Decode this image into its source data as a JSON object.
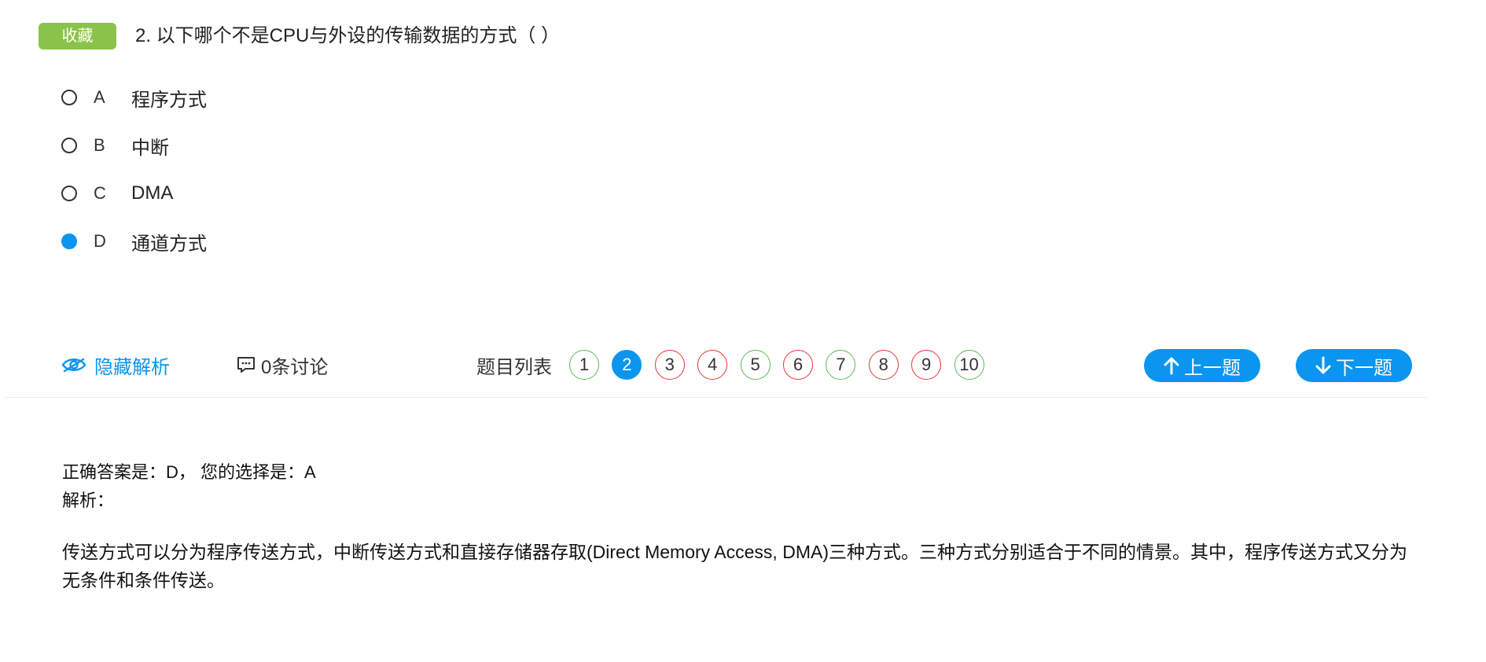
{
  "question": {
    "favorite_label": "收藏",
    "title": "2. 以下哪个不是CPU与外设的传输数据的方式（ ）",
    "options": [
      {
        "letter": "A",
        "text": "程序方式",
        "selected": false
      },
      {
        "letter": "B",
        "text": "中断",
        "selected": false
      },
      {
        "letter": "C",
        "text": "DMA",
        "selected": false
      },
      {
        "letter": "D",
        "text": "通道方式",
        "selected": true
      }
    ]
  },
  "toolbar": {
    "hide_analysis_label": "隐藏解析",
    "hide_analysis_icon": "eye-icon",
    "discussion_label": "0条讨论",
    "discussion_icon": "comment-icon",
    "question_list_label": "题目列表",
    "question_numbers": [
      {
        "num": "1",
        "status": "right"
      },
      {
        "num": "2",
        "status": "current"
      },
      {
        "num": "3",
        "status": "wrong"
      },
      {
        "num": "4",
        "status": "wrong"
      },
      {
        "num": "5",
        "status": "right"
      },
      {
        "num": "6",
        "status": "wrong"
      },
      {
        "num": "7",
        "status": "right"
      },
      {
        "num": "8",
        "status": "wrong"
      },
      {
        "num": "9",
        "status": "wrong"
      },
      {
        "num": "10",
        "status": "right"
      }
    ],
    "prev_label": "上一题",
    "next_label": "下一题"
  },
  "analysis": {
    "answer_line": "正确答案是：D， 您的选择是：A",
    "label": "解析：",
    "text": "传送方式可以分为程序传送方式，中断传送方式和直接存储器存取(Direct Memory Access, DMA)三种方式。三种方式分别适合于不同的情景。其中，程序传送方式又分为无条件和条件传送。"
  },
  "colors": {
    "accent": "#0a95f0",
    "favorite": "#8bc34a",
    "correct_ring": "#5cb85c",
    "wrong_ring": "#e53935"
  }
}
